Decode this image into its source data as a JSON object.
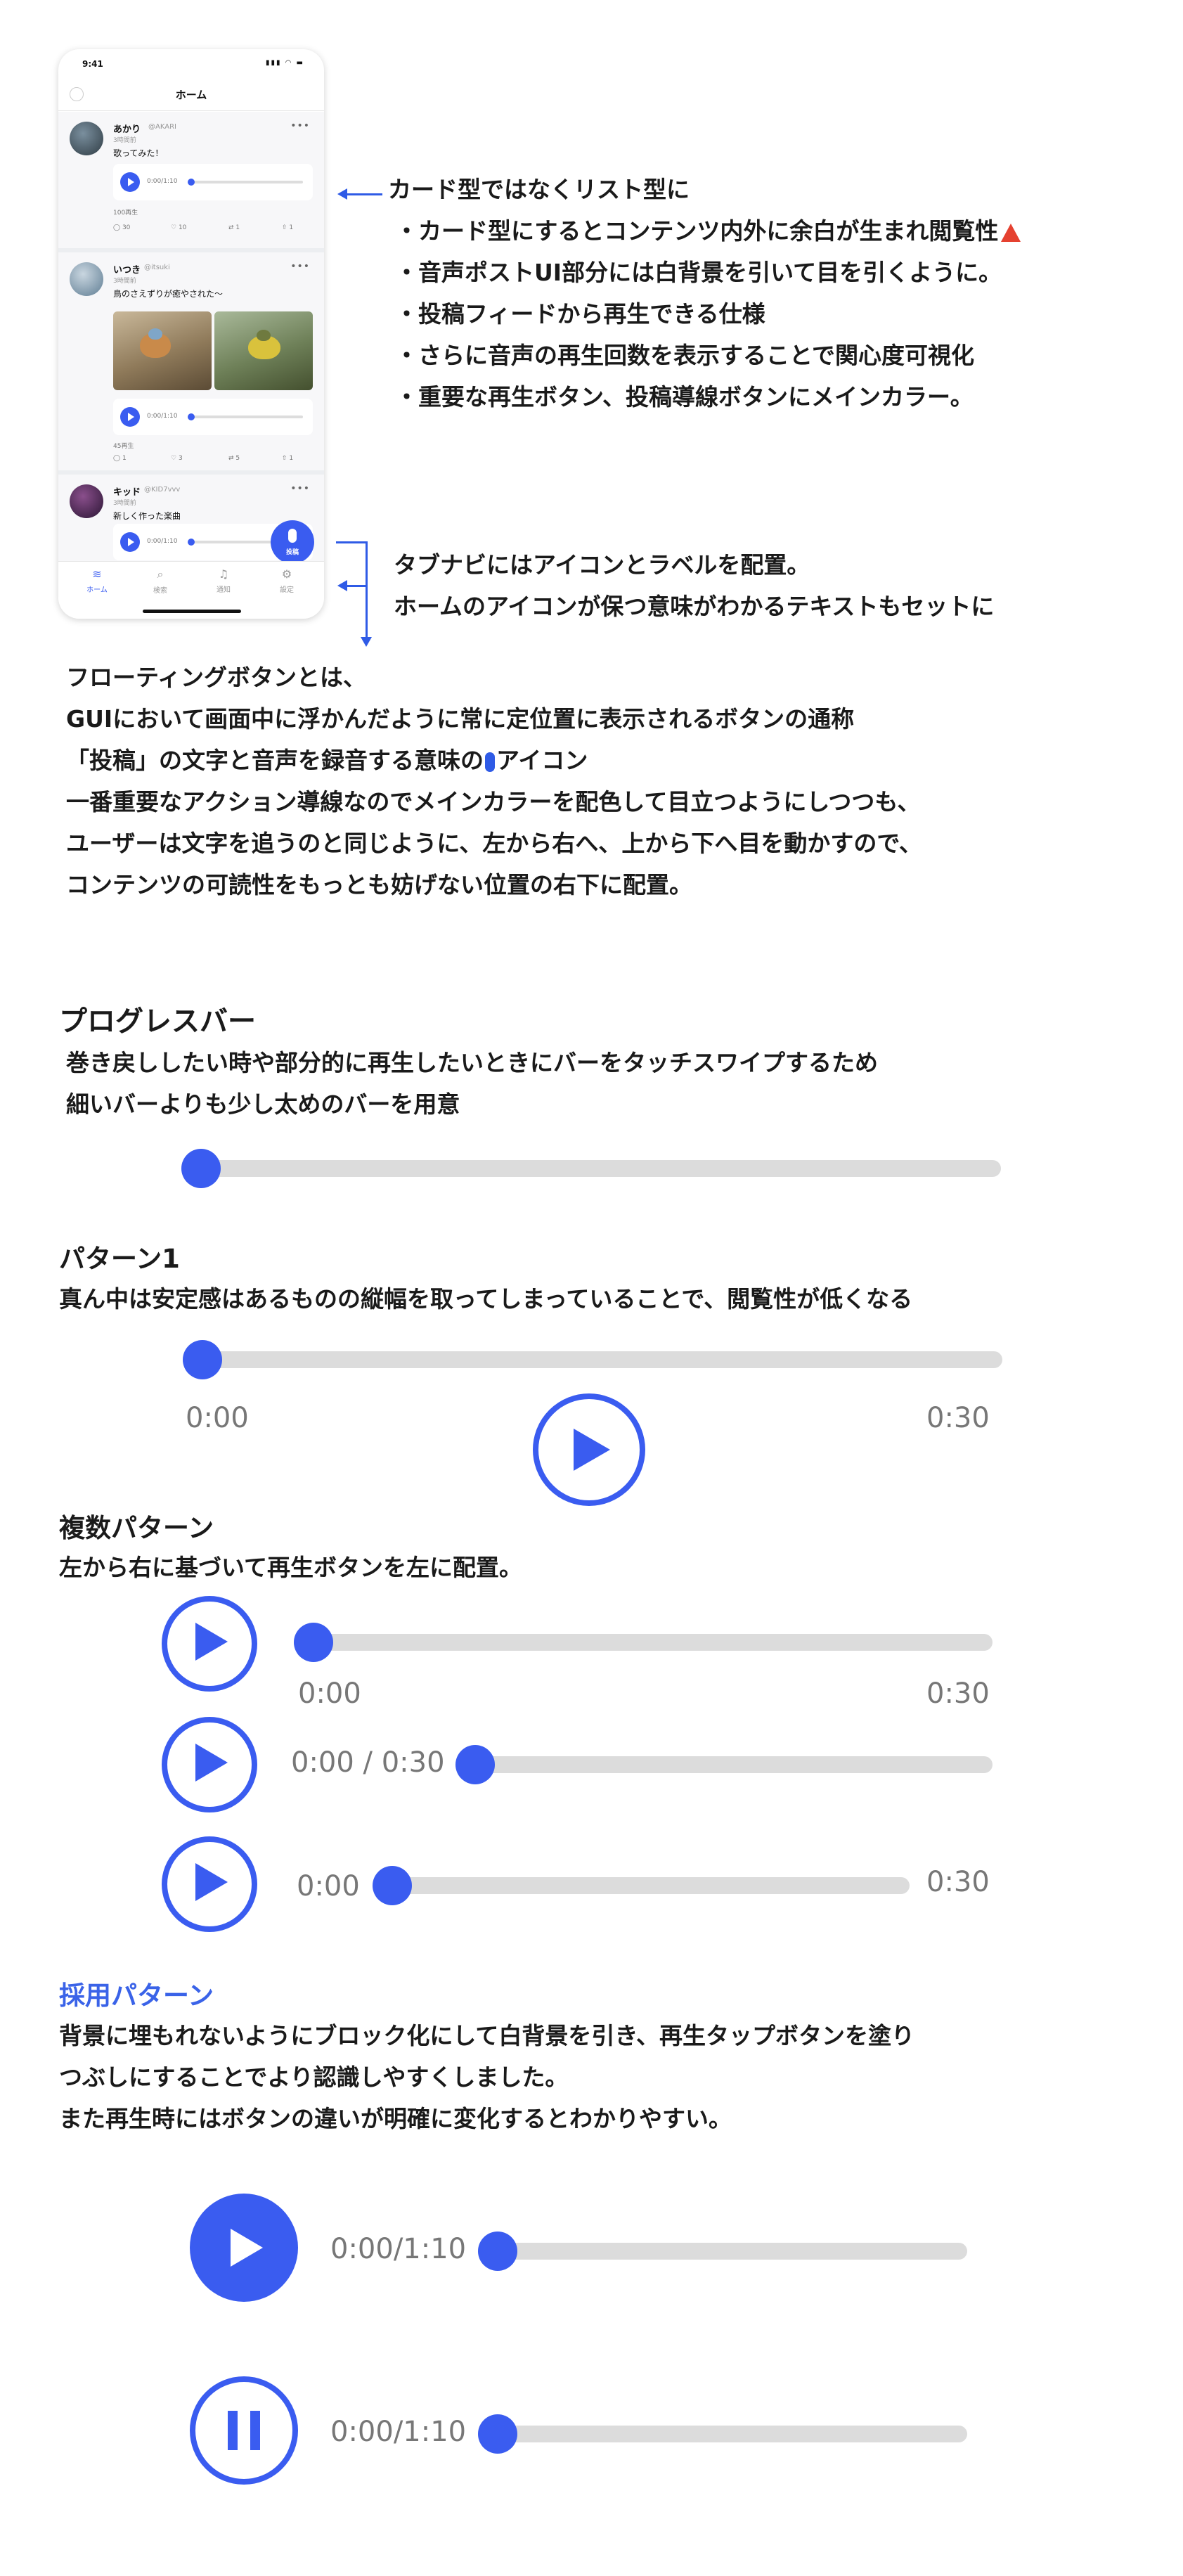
{
  "phone": {
    "status_time": "9:41",
    "status_icons": "▮▮▮ ◠ ▬",
    "header_title": "ホーム",
    "posts": [
      {
        "name": "あかり",
        "handle": "@AKARI",
        "ago": "3時間前",
        "text": "歌ってみた！",
        "player_time": "0:00/1:10",
        "plays": "100再生",
        "comments": "30",
        "likes": "10",
        "reposts": "1",
        "shares": "1"
      },
      {
        "name": "いつき",
        "handle": "@itsuki",
        "ago": "3時間前",
        "text": "鳥のさえずりが癒やされた〜",
        "player_time": "0:00/1:10",
        "plays": "45再生",
        "comments": "1",
        "likes": "3",
        "reposts": "5",
        "shares": "1"
      },
      {
        "name": "キッド",
        "handle": "@KID7vvv",
        "ago": "3時間前",
        "text": "新しく作った楽曲",
        "player_time": "0:00/1:10"
      }
    ],
    "fab_label": "投稿",
    "tabs": [
      {
        "icon": "≋",
        "label": "ホーム"
      },
      {
        "icon": "⌕",
        "label": "検索"
      },
      {
        "icon": "♫",
        "label": "通知"
      },
      {
        "icon": "⚙",
        "label": "設定"
      }
    ]
  },
  "notes": {
    "list_style": {
      "lines": [
        "カード型ではなくリスト型に",
        "・カード型にするとコンテンツ内外に余白が生まれ閲覧性",
        "・音声ポストUI部分には白背景を引いて目を引くように。",
        "・投稿フィードから再生できる仕様",
        "・さらに音声の再生回数を表示することで関心度可視化",
        "・重要な再生ボタン、投稿導線ボタンにメインカラー。"
      ]
    },
    "tab_nav": {
      "lines": [
        "タブナビにはアイコンとラベルを配置。",
        "ホームのアイコンが保つ意味がわかるテキストもセットに"
      ]
    },
    "floating": {
      "line1": "フローティングボタンとは、",
      "line2": "GUIにおいて画面中に浮かんだように常に定位置に表示されるボタンの通称",
      "line3a": "「投稿」の文字と音声を録音する意味の",
      "line3b": "アイコン",
      "line4": "一番重要なアクション導線なのでメインカラーを配色して目立つようにしつつも、",
      "line5": "ユーザーは文字を追うのと同じように、左から右へ、上から下へ目を動かすので、",
      "line6": "コンテンツの可読性をもっとも妨げない位置の右下に配置。"
    }
  },
  "progress": {
    "title": "プログレスバー",
    "desc1": "巻き戻ししたい時や部分的に再生したいときにバーをタッチスワイプするため",
    "desc2": "細いバーよりも少し太めのバーを用意"
  },
  "pattern1": {
    "title": "パターン1",
    "desc": "真ん中は安定感はあるものの縦幅を取ってしまっていることで、閲覧性が低くなる",
    "start": "0:00",
    "end": "0:30"
  },
  "multi": {
    "title": "複数パターン",
    "desc": "左から右に基づいて再生ボタンを左に配置。",
    "a_start": "0:00",
    "a_end": "0:30",
    "b_time": "0:00 / 0:30",
    "c_start": "0:00",
    "c_end": "0:30"
  },
  "adopted": {
    "title": "採用パターン",
    "desc1": "背景に埋もれないようにブロック化にして白背景を引き、再生タップボタンを塗り",
    "desc2": "つぶしにすることでより認識しやすくしました。",
    "desc3": "また再生時にはボタンの違いが明確に変化するとわかりやすい。",
    "play_time": "0:00/1:10",
    "pause_time": "0:00/1:10"
  },
  "colors": {
    "accent": "#3a5cf0",
    "track": "#dcdcdc",
    "warning": "#e54130"
  }
}
